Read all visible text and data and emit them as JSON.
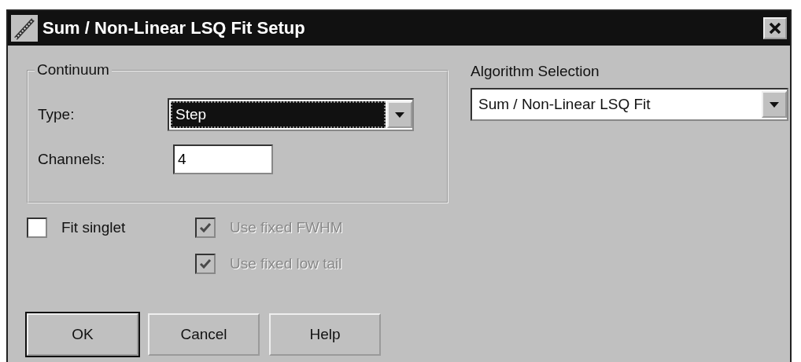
{
  "window": {
    "title": "Sum / Non-Linear LSQ Fit Setup"
  },
  "continuum": {
    "title": "Continuum",
    "type": {
      "label": "Type:",
      "value": "Step",
      "focused": true
    },
    "channels": {
      "label": "Channels:",
      "value": "4"
    }
  },
  "checkboxes": [
    {
      "label": "Fit singlet",
      "checked": false,
      "disabled": false
    },
    {
      "label": "Use fixed FWHM",
      "checked": true,
      "disabled": true
    },
    {
      "label": "Use fixed low tail",
      "checked": true,
      "disabled": true
    }
  ],
  "buttons": [
    {
      "label": "OK",
      "default": true
    },
    {
      "label": "Cancel",
      "default": false
    },
    {
      "label": "Help",
      "default": false
    }
  ],
  "algorithm": {
    "label": "Algorithm Selection",
    "value": "Sum / Non-Linear LSQ Fit"
  }
}
